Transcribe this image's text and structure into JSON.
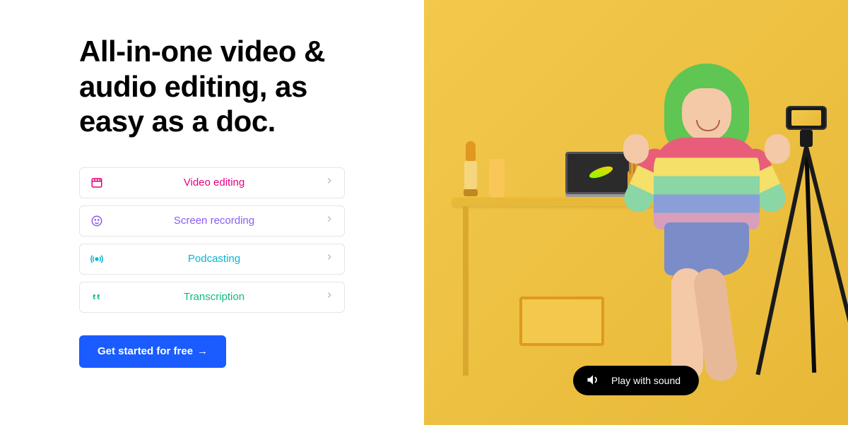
{
  "hero": {
    "headline": "All-in-one video & audio editing, as easy as a doc."
  },
  "features": [
    {
      "label": "Video editing",
      "color": "#e6007e",
      "icon": "film-icon"
    },
    {
      "label": "Screen recording",
      "color": "#8b5cf6",
      "icon": "face-icon"
    },
    {
      "label": "Podcasting",
      "color": "#06b6d4",
      "icon": "broadcast-icon"
    },
    {
      "label": "Transcription",
      "color": "#10b981",
      "icon": "quote-icon"
    }
  ],
  "cta": {
    "label": "Get started for free",
    "arrow": "→"
  },
  "video": {
    "sound_label": "Play with sound"
  }
}
